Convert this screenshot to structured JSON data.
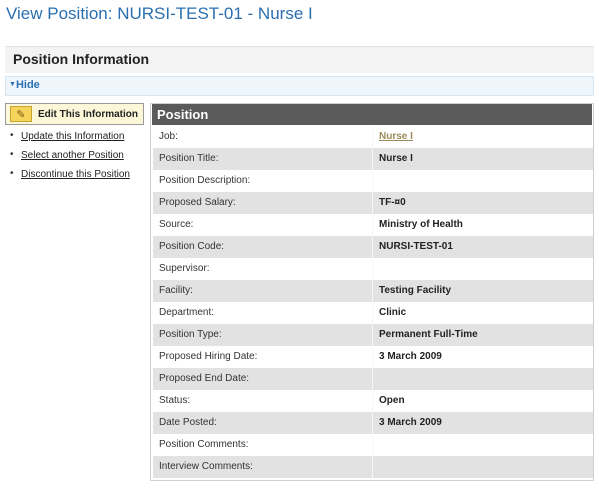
{
  "page": {
    "title": "View Position: NURSI-TEST-01 - Nurse I"
  },
  "section": {
    "title": "Position Information",
    "hide_label": "Hide"
  },
  "sidebar": {
    "edit_button": "Edit This Information",
    "links": [
      "Update this Information",
      "Select another Position",
      "Discontinue this Position"
    ]
  },
  "panel": {
    "title": "Position",
    "rows": [
      {
        "label": "Job:",
        "value": "Nurse I"
      },
      {
        "label": "Position Title:",
        "value": "Nurse I"
      },
      {
        "label": "Position Description:",
        "value": ""
      },
      {
        "label": "Proposed Salary:",
        "value": "TF-¤0"
      },
      {
        "label": "Source:",
        "value": "Ministry of Health"
      },
      {
        "label": "Position Code:",
        "value": "NURSI-TEST-01"
      },
      {
        "label": "Supervisor:",
        "value": ""
      },
      {
        "label": "Facility:",
        "value": "Testing Facility"
      },
      {
        "label": "Department:",
        "value": "Clinic"
      },
      {
        "label": "Position Type:",
        "value": "Permanent Full-Time"
      },
      {
        "label": "Proposed Hiring Date:",
        "value": "3 March 2009"
      },
      {
        "label": "Proposed End Date:",
        "value": ""
      },
      {
        "label": "Status:",
        "value": "Open"
      },
      {
        "label": "Date Posted:",
        "value": "3 March 2009"
      },
      {
        "label": "Position Comments:",
        "value": ""
      },
      {
        "label": "Interview Comments:",
        "value": ""
      }
    ]
  },
  "colors": {
    "title_link": "#2a6fb0",
    "panel_header": "#5a5a5a",
    "row_alt": "#e2e2e2",
    "edit_button_bg": "#fbf7d8"
  },
  "icons": {
    "edit": "pencil-icon",
    "hide_toggle": "triangle-down-icon",
    "bullet": "bullet-icon"
  }
}
